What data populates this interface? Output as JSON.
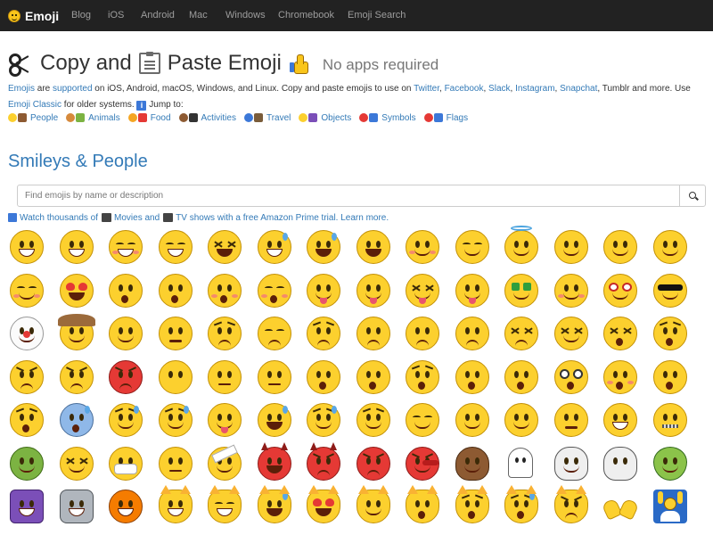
{
  "nav": {
    "brand": "Emoji",
    "items": [
      "Blog",
      "iOS",
      "Android",
      "Mac",
      "Windows",
      "Chromebook",
      "Emoji Search"
    ]
  },
  "headline": {
    "part1": "Copy and",
    "part2": "Paste Emoji",
    "tagline": "No apps required"
  },
  "description": {
    "l_emojis": "Emojis",
    "t1": " are ",
    "l_supported": "supported",
    "t2": " on iOS, Android, macOS, Windows, and Linux. Copy and paste emojis to use on ",
    "l_twitter": "Twitter",
    "t3": ", ",
    "l_facebook": "Facebook",
    "t4": ", ",
    "l_slack": "Slack",
    "t5": ", ",
    "l_instagram": "Instagram",
    "t6": ", ",
    "l_snapchat": "Snapchat",
    "t7": ", Tumblr and more. Use ",
    "l_classic": "Emoji Classic",
    "t8": " for older systems. ",
    "info_glyph": "i",
    "t9": " Jump to:"
  },
  "jump": [
    {
      "label": "People",
      "c1": "#fcd02e",
      "c2": "#8d5a32"
    },
    {
      "label": "Animals",
      "c1": "#d68a3c",
      "c2": "#7cb342"
    },
    {
      "label": "Food",
      "c1": "#f5a623",
      "c2": "#e53935"
    },
    {
      "label": "Activities",
      "c1": "#8d5a32",
      "c2": "#333333"
    },
    {
      "label": "Travel",
      "c1": "#3c78d8",
      "c2": "#7a5c3a"
    },
    {
      "label": "Objects",
      "c1": "#fcd02e",
      "c2": "#7b4fb8"
    },
    {
      "label": "Symbols",
      "c1": "#e53935",
      "c2": "#3c78d8"
    },
    {
      "label": "Flags",
      "c1": "#e53935",
      "c2": "#3c78d8"
    }
  ],
  "section": {
    "title": "Smileys & People"
  },
  "search": {
    "placeholder": "Find emojis by name or description"
  },
  "promo": {
    "link1": "Watch thousands of",
    "link2": "Movies and",
    "link3": "TV shows with a free Amazon Prime trial. Learn more."
  },
  "emojis": [
    "grinning-face",
    "grinning-face-big-eyes",
    "grinning-face-smiling-eyes",
    "beaming-face",
    "squinting-laughing",
    "grinning-sweat",
    "tears-of-joy",
    "rolling-laughing",
    "smiling-face",
    "smiling-closed-eyes",
    "halo-face",
    "slightly-smiling",
    "upside-down-face",
    "winking-face",
    "relieved-face",
    "heart-eyes",
    "kissing-heart",
    "kissing-face",
    "kissing-smiling-eyes",
    "kissing-closed-eyes",
    "savoring-food",
    "tongue-out",
    "squinting-tongue",
    "winking-tongue",
    "money-mouth",
    "hugging-face",
    "nerd-face",
    "sunglasses-face",
    "clown-face",
    "cowboy-face",
    "smirking-face",
    "unamused-face",
    "disappointed-face",
    "pensive-face",
    "worried-face",
    "confused-face",
    "slightly-frowning",
    "frowning-face",
    "persevering-face",
    "confounded-face",
    "tired-face",
    "weary-face",
    "steam-nose",
    "angry-face",
    "pouting-face",
    "no-mouth",
    "neutral-face",
    "expressionless",
    "hushed-face",
    "frowning-open-mouth",
    "anguished-face",
    "open-mouth",
    "astonished-face",
    "dizzy-face",
    "flushed-face",
    "screaming-face",
    "fearful-face",
    "cold-sweat",
    "crying-face",
    "disappointed-relieved",
    "drooling-face",
    "loudly-crying",
    "downcast-sweat",
    "sleepy-face",
    "sleeping-face",
    "rolling-eyes",
    "thinking-face",
    "lying-face",
    "grimacing-face",
    "zipper-mouth",
    "nauseated-face",
    "sneezing-face",
    "medical-mask",
    "thermometer-face",
    "bandage-face",
    "smiling-horns",
    "angry-horns",
    "ogre",
    "goblin",
    "pile-of-poo",
    "ghost",
    "skull",
    "skull-crossbones",
    "alien",
    "alien-monster",
    "robot-face",
    "jack-o-lantern",
    "grinning-cat",
    "grinning-cat-smiling-eyes",
    "cat-tears-of-joy",
    "heart-eyes-cat",
    "wry-cat",
    "kissing-cat",
    "weary-cat",
    "crying-cat",
    "pouting-cat",
    "palms-up",
    "raising-hands"
  ]
}
